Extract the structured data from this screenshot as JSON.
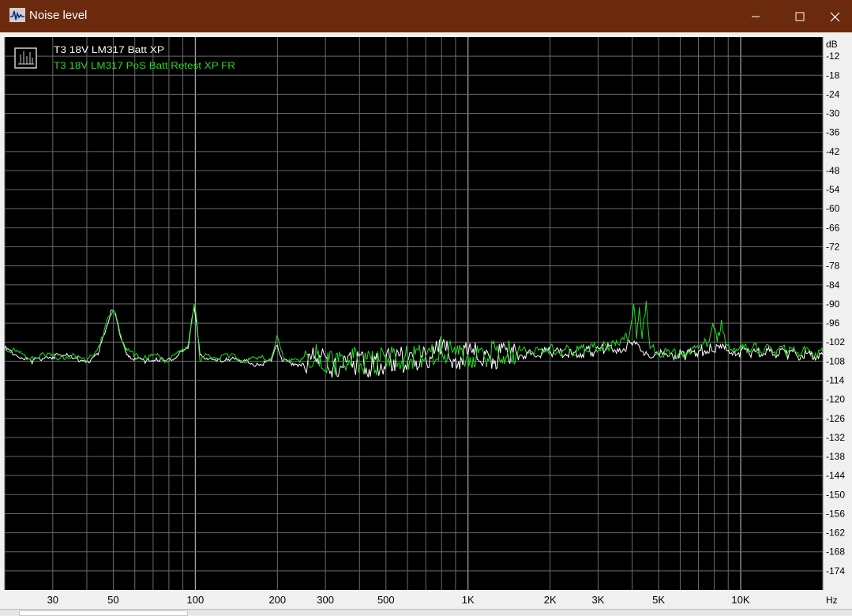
{
  "window": {
    "title": "Noise level",
    "icon": "waveform-icon",
    "controls": [
      "minimize-icon",
      "maximize-icon",
      "close-icon"
    ]
  },
  "chart_data": {
    "type": "line",
    "xscale": "log",
    "xlim": [
      20,
      20000
    ],
    "ylim": [
      -180,
      -6
    ],
    "xlabel": "Hz",
    "ylabel": "dB",
    "grid": true,
    "legend": "top-left",
    "background": "#000000",
    "x_ticks": [
      {
        "value": 30,
        "label": "30"
      },
      {
        "value": 50,
        "label": "50"
      },
      {
        "value": 100,
        "label": "100"
      },
      {
        "value": 200,
        "label": "200"
      },
      {
        "value": 300,
        "label": "300"
      },
      {
        "value": 500,
        "label": "500"
      },
      {
        "value": 1000,
        "label": "1K"
      },
      {
        "value": 2000,
        "label": "2K"
      },
      {
        "value": 3000,
        "label": "3K"
      },
      {
        "value": 5000,
        "label": "5K"
      },
      {
        "value": 10000,
        "label": "10K"
      }
    ],
    "y_ticks": [
      -12,
      -18,
      -24,
      -30,
      -36,
      -42,
      -48,
      -54,
      -60,
      -66,
      -72,
      -78,
      -84,
      -90,
      -96,
      -102,
      -108,
      -114,
      -120,
      -126,
      -132,
      -138,
      -144,
      -150,
      -156,
      -162,
      -168,
      -174
    ],
    "series": [
      {
        "name": "T3 18V LM317 Batt XP",
        "color": "#ffffff",
        "points": [
          [
            20,
            -104
          ],
          [
            22,
            -106
          ],
          [
            25,
            -108
          ],
          [
            28,
            -107
          ],
          [
            32,
            -106
          ],
          [
            36,
            -107
          ],
          [
            40,
            -108
          ],
          [
            44,
            -106
          ],
          [
            47,
            -98
          ],
          [
            49,
            -92
          ],
          [
            51,
            -93
          ],
          [
            53,
            -100
          ],
          [
            56,
            -106
          ],
          [
            60,
            -107
          ],
          [
            66,
            -108
          ],
          [
            72,
            -107
          ],
          [
            78,
            -108
          ],
          [
            84,
            -107
          ],
          [
            90,
            -105
          ],
          [
            94,
            -104
          ],
          [
            97,
            -95
          ],
          [
            99,
            -91
          ],
          [
            101,
            -96
          ],
          [
            104,
            -106
          ],
          [
            110,
            -107
          ],
          [
            120,
            -108
          ],
          [
            130,
            -107
          ],
          [
            150,
            -108
          ],
          [
            170,
            -109
          ],
          [
            190,
            -108
          ],
          [
            200,
            -103
          ],
          [
            210,
            -108
          ],
          [
            240,
            -109
          ],
          [
            280,
            -107
          ],
          [
            320,
            -110
          ],
          [
            380,
            -108
          ],
          [
            450,
            -110
          ],
          [
            520,
            -107
          ],
          [
            600,
            -108
          ],
          [
            700,
            -107
          ],
          [
            800,
            -105
          ],
          [
            900,
            -107
          ],
          [
            1000,
            -106
          ],
          [
            1200,
            -107
          ],
          [
            1400,
            -106
          ],
          [
            1700,
            -106
          ],
          [
            2000,
            -105
          ],
          [
            2400,
            -106
          ],
          [
            2800,
            -105
          ],
          [
            3200,
            -104
          ],
          [
            3600,
            -104
          ],
          [
            4000,
            -103
          ],
          [
            4500,
            -105
          ],
          [
            5000,
            -106
          ],
          [
            5500,
            -106
          ],
          [
            6200,
            -106
          ],
          [
            7000,
            -105
          ],
          [
            7800,
            -104
          ],
          [
            8500,
            -104
          ],
          [
            9500,
            -105
          ],
          [
            11000,
            -105
          ],
          [
            13000,
            -105
          ],
          [
            15000,
            -106
          ],
          [
            18000,
            -106
          ],
          [
            20000,
            -106
          ]
        ]
      },
      {
        "name": "T3 18V LM317 PoS Batt Retest XP FR",
        "color": "#22dd22",
        "points": [
          [
            20,
            -104
          ],
          [
            22,
            -105
          ],
          [
            25,
            -107
          ],
          [
            28,
            -106
          ],
          [
            32,
            -107
          ],
          [
            36,
            -106
          ],
          [
            40,
            -108
          ],
          [
            43,
            -105
          ],
          [
            46,
            -100
          ],
          [
            48,
            -94
          ],
          [
            50,
            -92
          ],
          [
            52,
            -96
          ],
          [
            55,
            -104
          ],
          [
            60,
            -106
          ],
          [
            66,
            -107
          ],
          [
            72,
            -106
          ],
          [
            78,
            -108
          ],
          [
            84,
            -106
          ],
          [
            90,
            -104
          ],
          [
            94,
            -103
          ],
          [
            97,
            -96
          ],
          [
            99,
            -90
          ],
          [
            101,
            -94
          ],
          [
            104,
            -108
          ],
          [
            110,
            -106
          ],
          [
            120,
            -107
          ],
          [
            135,
            -106
          ],
          [
            150,
            -108
          ],
          [
            170,
            -107
          ],
          [
            190,
            -107
          ],
          [
            199,
            -100
          ],
          [
            210,
            -107
          ],
          [
            240,
            -108
          ],
          [
            280,
            -106
          ],
          [
            320,
            -109
          ],
          [
            380,
            -107
          ],
          [
            450,
            -109
          ],
          [
            520,
            -106
          ],
          [
            600,
            -107
          ],
          [
            700,
            -106
          ],
          [
            800,
            -104
          ],
          [
            900,
            -106
          ],
          [
            1000,
            -106
          ],
          [
            1200,
            -106
          ],
          [
            1400,
            -105
          ],
          [
            1700,
            -105
          ],
          [
            2000,
            -104
          ],
          [
            2400,
            -105
          ],
          [
            2800,
            -104
          ],
          [
            3200,
            -103
          ],
          [
            3600,
            -103
          ],
          [
            3900,
            -100
          ],
          [
            4050,
            -90
          ],
          [
            4150,
            -101
          ],
          [
            4250,
            -91
          ],
          [
            4350,
            -101
          ],
          [
            4500,
            -89
          ],
          [
            4650,
            -104
          ],
          [
            5000,
            -105
          ],
          [
            5500,
            -106
          ],
          [
            6200,
            -105
          ],
          [
            7000,
            -104
          ],
          [
            7600,
            -102
          ],
          [
            7900,
            -96
          ],
          [
            8200,
            -102
          ],
          [
            8500,
            -95
          ],
          [
            8800,
            -103
          ],
          [
            9500,
            -104
          ],
          [
            11000,
            -104
          ],
          [
            13000,
            -104
          ],
          [
            15000,
            -105
          ],
          [
            18000,
            -105
          ],
          [
            20000,
            -105
          ]
        ]
      }
    ]
  }
}
